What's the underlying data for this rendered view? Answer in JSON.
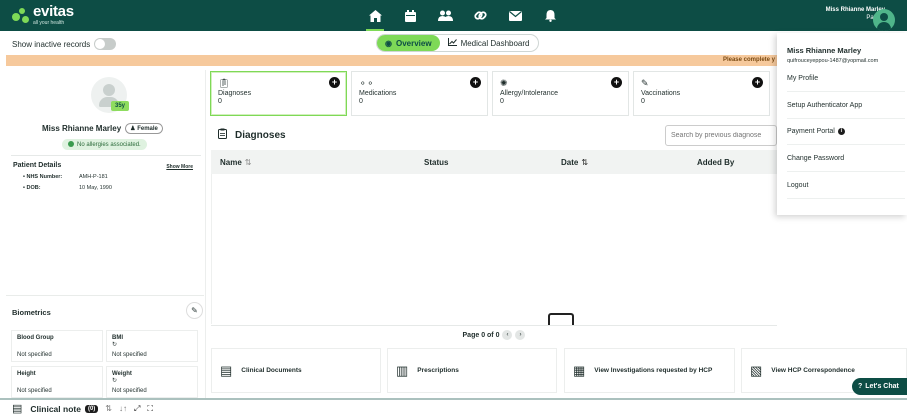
{
  "brand": {
    "name": "evitas",
    "tagline": "all your health",
    "accent": "#7ed957",
    "primary": "#0d4d45"
  },
  "nav": {
    "icons": [
      "home-icon",
      "calendar-icon",
      "people-icon",
      "link-icon",
      "mail-icon",
      "bell-icon"
    ]
  },
  "user": {
    "name": "Miss Rhianne Marley",
    "role": "Patient"
  },
  "toolbar": {
    "show_inactive_label": "Show inactive records",
    "show_inactive_on": false
  },
  "tabs": {
    "overview": "Overview",
    "dashboard": "Medical Dashboard"
  },
  "banner": {
    "text": "Please complete y"
  },
  "patient": {
    "age": "35y",
    "name": "Miss Rhianne Marley",
    "gender": "Female",
    "allergy_status": "No allergies associated.",
    "details_title": "Patient Details",
    "show_more": "Show More",
    "nhs_label": "NHS Number:",
    "nhs_value": "AMH-P-181",
    "dob_label": "DOB:",
    "dob_value": "10 May, 1990"
  },
  "biometrics": {
    "title": "Biometrics",
    "blood_group_label": "Blood Group",
    "blood_group_value": "Not specified",
    "bmi_label": "BMI",
    "bmi_value": "Not specified",
    "height_label": "Height",
    "height_value": "Not specified",
    "weight_label": "Weight",
    "weight_value": "Not specified"
  },
  "cards": [
    {
      "label": "Diagnoses",
      "count": "0"
    },
    {
      "label": "Medications",
      "count": "0"
    },
    {
      "label": "Allergy/Intolerance",
      "count": "0"
    },
    {
      "label": "Vaccinations",
      "count": "0"
    }
  ],
  "diagnoses": {
    "title": "Diagnoses",
    "search_placeholder": "Search by previous diagnose",
    "columns": [
      "Name",
      "Status",
      "Date",
      "Added By"
    ],
    "page_text": "Page 0 of 0"
  },
  "bottom_cards": [
    {
      "label": "Clinical Documents"
    },
    {
      "label": "Prescriptions"
    },
    {
      "label": "View Investigations requested by HCP"
    },
    {
      "label": "View HCP Correspondence"
    }
  ],
  "chat": {
    "label": "Let's Chat"
  },
  "clinical_note": {
    "label": "Clinical note",
    "count": "(0)"
  },
  "dropdown": {
    "name": "Miss Rhianne Marley",
    "email": "quifrouceyeppou-1487@yopmail.com",
    "items": [
      "My Profile",
      "Setup Authenticator App",
      "Payment Portal",
      "Change Password",
      "Logout"
    ]
  }
}
